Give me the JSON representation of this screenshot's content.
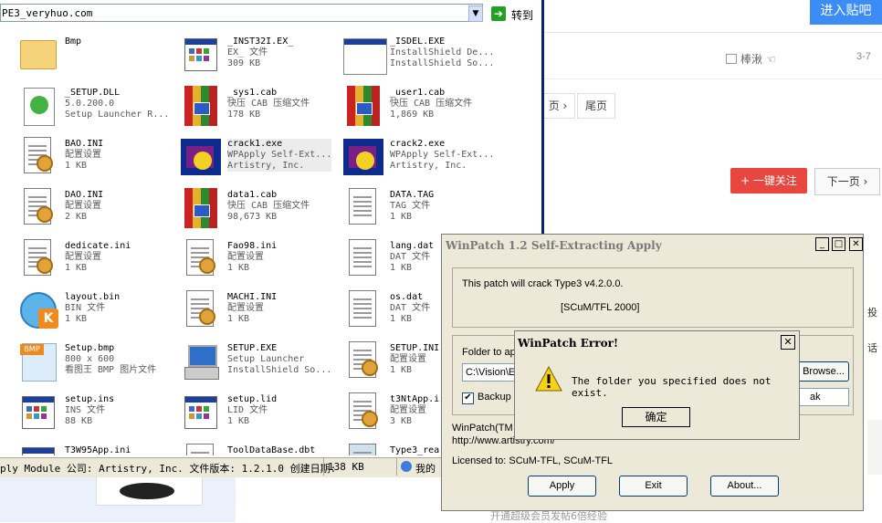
{
  "web": {
    "post_button": "进入贴吧",
    "user_name": "棒湫 ☜",
    "date": "3-7",
    "pager_next": "页 ›",
    "pager_last": "尾页",
    "follow_button": "+ 一键关注",
    "next_page_button": "下一页 ›",
    "side_text_1": "投",
    "side_text_2": "话",
    "footer_text": "开通超级会员发帖6倍经验"
  },
  "explorer": {
    "address": "PE3_veryhuo.com",
    "go_label": "转到",
    "items": [
      {
        "name": "Bmp",
        "l2": "",
        "l3": ""
      },
      {
        "name": "_INST32I.EX_",
        "l2": "EX_ 文件",
        "l3": "309 KB"
      },
      {
        "name": "_ISDEL.EXE",
        "l2": "InstallShield De...",
        "l3": "InstallShield So..."
      },
      {
        "name": "_SETUP.DLL",
        "l2": "5.0.200.0",
        "l3": "Setup Launcher R..."
      },
      {
        "name": "_sys1.cab",
        "l2": "快压 CAB 压缩文件",
        "l3": "178 KB"
      },
      {
        "name": "_user1.cab",
        "l2": "快压 CAB 压缩文件",
        "l3": "1,869 KB"
      },
      {
        "name": "BAO.INI",
        "l2": "配置设置",
        "l3": "1 KB"
      },
      {
        "name": "crack1.exe",
        "l2": "WPApply Self-Ext...",
        "l3": "Artistry, Inc."
      },
      {
        "name": "crack2.exe",
        "l2": "WPApply Self-Ext...",
        "l3": "Artistry, Inc."
      },
      {
        "name": "DAO.INI",
        "l2": "配置设置",
        "l3": "2 KB"
      },
      {
        "name": "data1.cab",
        "l2": "快压 CAB 压缩文件",
        "l3": "98,673 KB"
      },
      {
        "name": "DATA.TAG",
        "l2": "TAG 文件",
        "l3": "1 KB"
      },
      {
        "name": "dedicate.ini",
        "l2": "配置设置",
        "l3": "1 KB"
      },
      {
        "name": "Fao98.ini",
        "l2": "配置设置",
        "l3": "1 KB"
      },
      {
        "name": "lang.dat",
        "l2": "DAT 文件",
        "l3": "1 KB"
      },
      {
        "name": "layout.bin",
        "l2": "BIN 文件",
        "l3": "1 KB"
      },
      {
        "name": "MACHI.INI",
        "l2": "配置设置",
        "l3": "1 KB"
      },
      {
        "name": "os.dat",
        "l2": "DAT 文件",
        "l3": "1 KB"
      },
      {
        "name": "Setup.bmp",
        "l2": "800 x 600",
        "l3": "看图王 BMP 图片文件"
      },
      {
        "name": "SETUP.EXE",
        "l2": "Setup Launcher",
        "l3": "InstallShield So..."
      },
      {
        "name": "SETUP.INI",
        "l2": "配置设置",
        "l3": "1 KB"
      },
      {
        "name": "setup.ins",
        "l2": "INS 文件",
        "l3": "88 KB"
      },
      {
        "name": "setup.lid",
        "l2": "LID 文件",
        "l3": "1 KB"
      },
      {
        "name": "t3NtApp.i",
        "l2": "配置设置",
        "l3": "3 KB"
      },
      {
        "name": "T3W95App.ini",
        "l2": "",
        "l3": ""
      },
      {
        "name": "ToolDataBase.dbt",
        "l2": "",
        "l3": ""
      },
      {
        "name": "Type3_rea",
        "l2": "",
        "l3": ""
      }
    ],
    "status_text": "ply Module 公司: Artistry, Inc. 文件版本: 1.2.1.0 创建日期:",
    "status_size": "138 KB",
    "status_zone": "我的"
  },
  "winpatch": {
    "title": "WinPatch 1.2 Self-Extracting Apply",
    "line1": "This patch will crack Type3 v4.2.0.0.",
    "line2": "[SCuM/TFL 2000]",
    "folder_label": "Folder to ap",
    "folder_value": "C:\\Vision\\E",
    "browse_label": "Browse...",
    "backup_label": "Backup",
    "ext_value": "ak",
    "credit1": "WinPatch(TM",
    "credit2": "http://www.artistry.com/",
    "licensed": "Licensed to:  SCuM-TFL, SCuM-TFL",
    "apply_label": "Apply",
    "exit_label": "Exit",
    "about_label": "About..."
  },
  "error_dialog": {
    "title": "WinPatch Error!",
    "message": "The folder you specified does not exist.",
    "ok_label": "确定"
  }
}
